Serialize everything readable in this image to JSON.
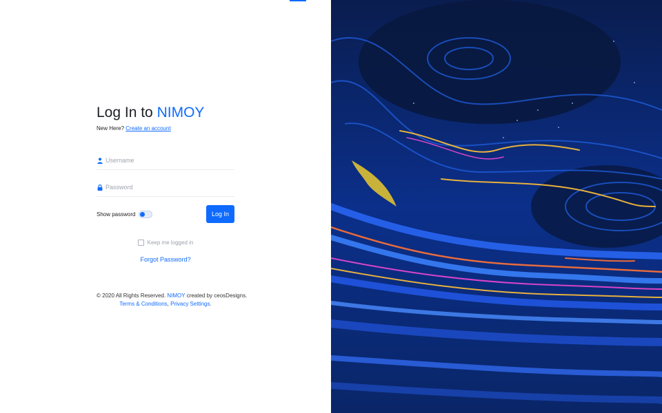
{
  "login": {
    "title_prefix": "Log In to ",
    "brand": "NIMOY",
    "new_here": "New Here?",
    "create_account": "Create an account",
    "username_placeholder": "Username",
    "password_placeholder": "Password",
    "show_password": "Show password",
    "login_button": "Log In",
    "keep_logged_in": "Keep me logged in",
    "forgot_password": "Forgot Password?"
  },
  "footer": {
    "copyright": "© 2020 All Rights Reserved. ",
    "brand": "NIMOY",
    "created_by": " created by ceosDesigns.",
    "terms": "Terms & Conditions",
    "separator": ", ",
    "privacy": "Privacy Settings",
    "period": "."
  },
  "icons": {
    "username": "user-icon",
    "password": "lock-icon"
  },
  "colors": {
    "accent": "#0f6bff",
    "background_dark": "#0a1c4a"
  }
}
